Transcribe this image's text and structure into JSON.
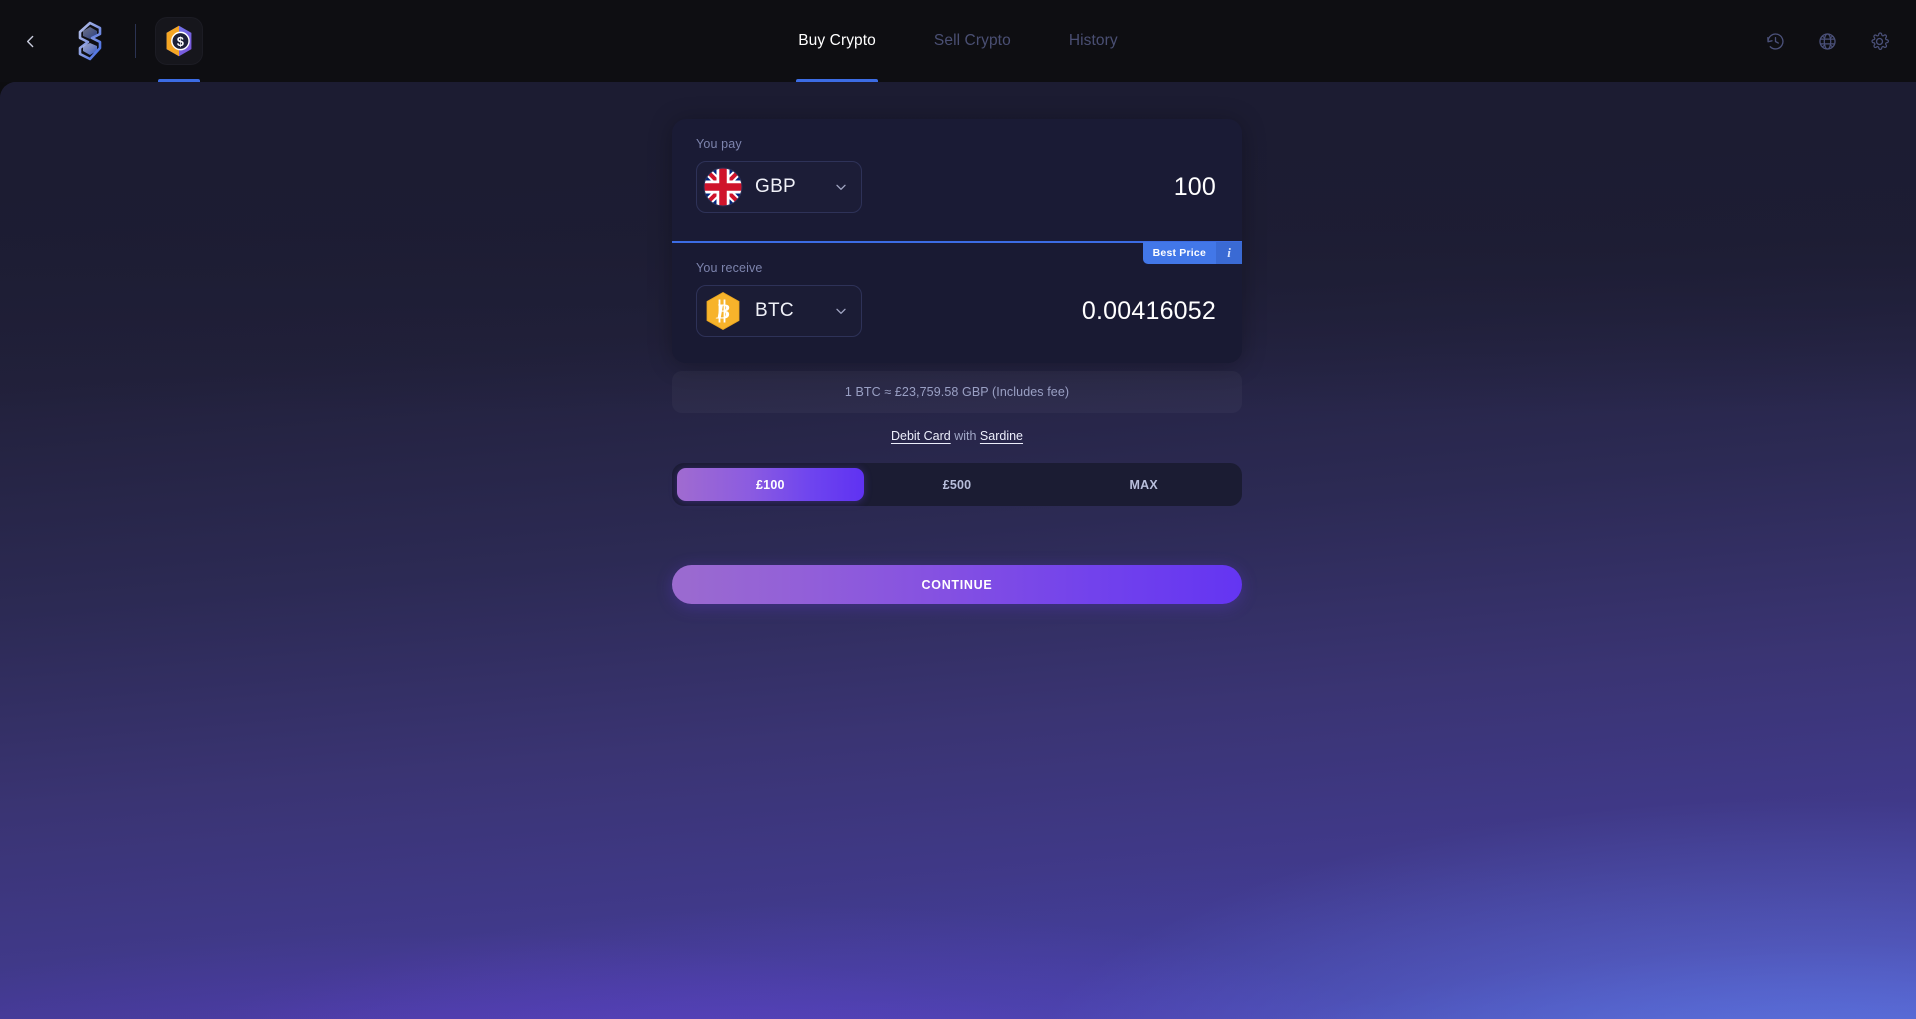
{
  "header": {
    "back_icon": "chevron-left-icon",
    "brand_icon": "brand-hexagon-logo",
    "app_icon": "dollar-hexagon-app-icon",
    "tabs": [
      {
        "label": "Buy Crypto",
        "active": true
      },
      {
        "label": "Sell Crypto",
        "active": false
      },
      {
        "label": "History",
        "active": false
      }
    ],
    "actions": [
      {
        "icon": "history-clock-icon"
      },
      {
        "icon": "globe-icon"
      },
      {
        "icon": "gear-icon"
      }
    ]
  },
  "widget": {
    "pay": {
      "label": "You pay",
      "currency": "GBP",
      "currency_icon": "uk-flag-icon",
      "amount": "100"
    },
    "receive": {
      "label": "You receive",
      "currency": "BTC",
      "currency_icon": "bitcoin-icon",
      "amount": "0.00416052",
      "badge": "Best Price",
      "badge_info": "i"
    },
    "rate": "1 BTC ≈ £23,759.58 GBP (Includes fee)",
    "payment_method": {
      "method": "Debit Card",
      "connector": "with",
      "provider": "Sardine"
    },
    "presets": [
      {
        "label": "£100",
        "active": true
      },
      {
        "label": "£500",
        "active": false
      },
      {
        "label": "MAX",
        "active": false
      }
    ],
    "continue_label": "CONTINUE"
  },
  "colors": {
    "accent_blue": "#3c6ce4",
    "badge_blue": "#4277e8",
    "purple_start": "#9b6bcf",
    "purple_end": "#6435f2",
    "card_bg": "#1a1b35",
    "header_bg": "#0e0e12",
    "bitcoin_orange": "#f7b32b"
  }
}
